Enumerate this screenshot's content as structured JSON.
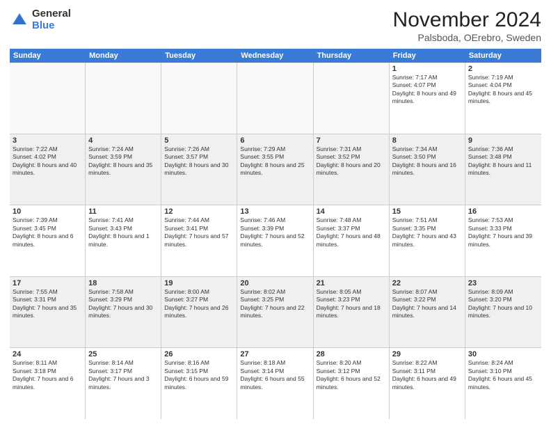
{
  "logo": {
    "general": "General",
    "blue": "Blue"
  },
  "title": "November 2024",
  "location": "Palsboda, OErebro, Sweden",
  "header_days": [
    "Sunday",
    "Monday",
    "Tuesday",
    "Wednesday",
    "Thursday",
    "Friday",
    "Saturday"
  ],
  "rows": [
    [
      {
        "day": "",
        "info": "",
        "empty": true
      },
      {
        "day": "",
        "info": "",
        "empty": true
      },
      {
        "day": "",
        "info": "",
        "empty": true
      },
      {
        "day": "",
        "info": "",
        "empty": true
      },
      {
        "day": "",
        "info": "",
        "empty": true
      },
      {
        "day": "1",
        "info": "Sunrise: 7:17 AM\nSunset: 4:07 PM\nDaylight: 8 hours and 49 minutes.",
        "empty": false
      },
      {
        "day": "2",
        "info": "Sunrise: 7:19 AM\nSunset: 4:04 PM\nDaylight: 8 hours and 45 minutes.",
        "empty": false
      }
    ],
    [
      {
        "day": "3",
        "info": "Sunrise: 7:22 AM\nSunset: 4:02 PM\nDaylight: 8 hours and 40 minutes.",
        "empty": false
      },
      {
        "day": "4",
        "info": "Sunrise: 7:24 AM\nSunset: 3:59 PM\nDaylight: 8 hours and 35 minutes.",
        "empty": false
      },
      {
        "day": "5",
        "info": "Sunrise: 7:26 AM\nSunset: 3:57 PM\nDaylight: 8 hours and 30 minutes.",
        "empty": false
      },
      {
        "day": "6",
        "info": "Sunrise: 7:29 AM\nSunset: 3:55 PM\nDaylight: 8 hours and 25 minutes.",
        "empty": false
      },
      {
        "day": "7",
        "info": "Sunrise: 7:31 AM\nSunset: 3:52 PM\nDaylight: 8 hours and 20 minutes.",
        "empty": false
      },
      {
        "day": "8",
        "info": "Sunrise: 7:34 AM\nSunset: 3:50 PM\nDaylight: 8 hours and 16 minutes.",
        "empty": false
      },
      {
        "day": "9",
        "info": "Sunrise: 7:36 AM\nSunset: 3:48 PM\nDaylight: 8 hours and 11 minutes.",
        "empty": false
      }
    ],
    [
      {
        "day": "10",
        "info": "Sunrise: 7:39 AM\nSunset: 3:45 PM\nDaylight: 8 hours and 6 minutes.",
        "empty": false
      },
      {
        "day": "11",
        "info": "Sunrise: 7:41 AM\nSunset: 3:43 PM\nDaylight: 8 hours and 1 minute.",
        "empty": false
      },
      {
        "day": "12",
        "info": "Sunrise: 7:44 AM\nSunset: 3:41 PM\nDaylight: 7 hours and 57 minutes.",
        "empty": false
      },
      {
        "day": "13",
        "info": "Sunrise: 7:46 AM\nSunset: 3:39 PM\nDaylight: 7 hours and 52 minutes.",
        "empty": false
      },
      {
        "day": "14",
        "info": "Sunrise: 7:48 AM\nSunset: 3:37 PM\nDaylight: 7 hours and 48 minutes.",
        "empty": false
      },
      {
        "day": "15",
        "info": "Sunrise: 7:51 AM\nSunset: 3:35 PM\nDaylight: 7 hours and 43 minutes.",
        "empty": false
      },
      {
        "day": "16",
        "info": "Sunrise: 7:53 AM\nSunset: 3:33 PM\nDaylight: 7 hours and 39 minutes.",
        "empty": false
      }
    ],
    [
      {
        "day": "17",
        "info": "Sunrise: 7:55 AM\nSunset: 3:31 PM\nDaylight: 7 hours and 35 minutes.",
        "empty": false
      },
      {
        "day": "18",
        "info": "Sunrise: 7:58 AM\nSunset: 3:29 PM\nDaylight: 7 hours and 30 minutes.",
        "empty": false
      },
      {
        "day": "19",
        "info": "Sunrise: 8:00 AM\nSunset: 3:27 PM\nDaylight: 7 hours and 26 minutes.",
        "empty": false
      },
      {
        "day": "20",
        "info": "Sunrise: 8:02 AM\nSunset: 3:25 PM\nDaylight: 7 hours and 22 minutes.",
        "empty": false
      },
      {
        "day": "21",
        "info": "Sunrise: 8:05 AM\nSunset: 3:23 PM\nDaylight: 7 hours and 18 minutes.",
        "empty": false
      },
      {
        "day": "22",
        "info": "Sunrise: 8:07 AM\nSunset: 3:22 PM\nDaylight: 7 hours and 14 minutes.",
        "empty": false
      },
      {
        "day": "23",
        "info": "Sunrise: 8:09 AM\nSunset: 3:20 PM\nDaylight: 7 hours and 10 minutes.",
        "empty": false
      }
    ],
    [
      {
        "day": "24",
        "info": "Sunrise: 8:11 AM\nSunset: 3:18 PM\nDaylight: 7 hours and 6 minutes.",
        "empty": false
      },
      {
        "day": "25",
        "info": "Sunrise: 8:14 AM\nSunset: 3:17 PM\nDaylight: 7 hours and 3 minutes.",
        "empty": false
      },
      {
        "day": "26",
        "info": "Sunrise: 8:16 AM\nSunset: 3:15 PM\nDaylight: 6 hours and 59 minutes.",
        "empty": false
      },
      {
        "day": "27",
        "info": "Sunrise: 8:18 AM\nSunset: 3:14 PM\nDaylight: 6 hours and 55 minutes.",
        "empty": false
      },
      {
        "day": "28",
        "info": "Sunrise: 8:20 AM\nSunset: 3:12 PM\nDaylight: 6 hours and 52 minutes.",
        "empty": false
      },
      {
        "day": "29",
        "info": "Sunrise: 8:22 AM\nSunset: 3:11 PM\nDaylight: 6 hours and 49 minutes.",
        "empty": false
      },
      {
        "day": "30",
        "info": "Sunrise: 8:24 AM\nSunset: 3:10 PM\nDaylight: 6 hours and 45 minutes.",
        "empty": false
      }
    ]
  ]
}
